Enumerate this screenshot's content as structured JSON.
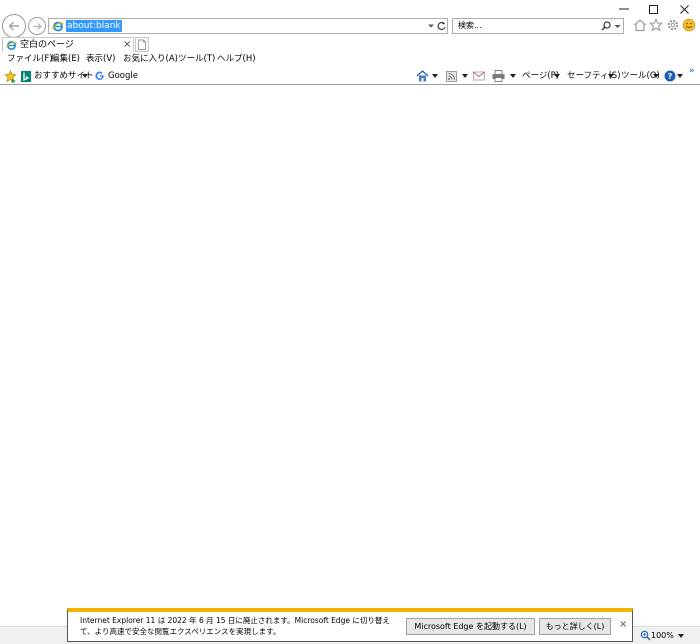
{
  "address_bar": {
    "url": "about:blank"
  },
  "search_box": {
    "placeholder": "検索..."
  },
  "tab": {
    "title": "空白のページ",
    "close_glyph": "×"
  },
  "menu": [
    {
      "label": "ファイル(F)"
    },
    {
      "label": "編集(E)"
    },
    {
      "label": "表示(V)"
    },
    {
      "label": "お気に入り(A)"
    },
    {
      "label": "ツール(T)"
    },
    {
      "label": "ヘルプ(H)"
    }
  ],
  "favorites_bar": {
    "links": [
      {
        "label": "おすすめサイト",
        "icon": "bing-icon"
      },
      {
        "label": "Google",
        "icon": "google-icon"
      }
    ],
    "overflow_glyph": "»"
  },
  "command_bar": {
    "page_label": "ページ(P)",
    "safety_label": "セーフティ(S)",
    "tools_label": "ツール(O)"
  },
  "status_bar": {
    "zoom": "100%"
  },
  "notification": {
    "message": "Internet Explorer 11 は 2022 年 6 月 15 日に廃止されます。Microsoft Edge に切り替えて、より高速で安全な閲覧エクスペリエンスを実現します。",
    "launch_edge_label": "Microsoft Edge を起動する(L)",
    "more_info_label": "もっと詳しく(L)",
    "close_glyph": "×"
  },
  "colors": {
    "selection": "#3399ff",
    "notification_accent": "#f2b400",
    "ie_logo": "#1e8fd8",
    "smiley": "#f5c02a"
  }
}
